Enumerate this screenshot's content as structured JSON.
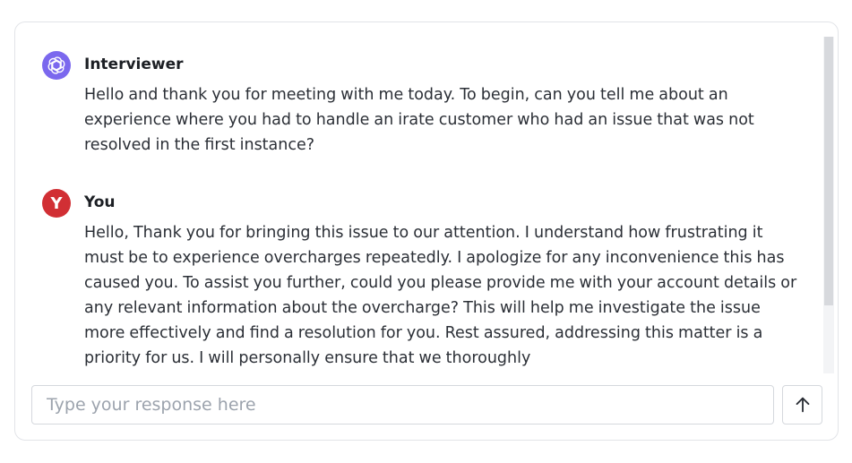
{
  "chat": {
    "messages": [
      {
        "sender": "Interviewer",
        "avatar_icon": "openai-logo-icon",
        "avatar_color": "#7b68ee",
        "text": "Hello and thank you for meeting with me today. To begin, can you tell me about an experience where you had to handle an irate customer who had an issue that was not resolved in the first instance?"
      },
      {
        "sender": "You",
        "avatar_letter": "Y",
        "avatar_color": "#d12f34",
        "text": "Hello, Thank you for bringing this issue to our attention. I understand how frustrating it must be to experience overcharges repeatedly. I apologize for any inconvenience this has caused you. To assist you further, could you please provide me with your account details or any relevant information about the overcharge? This will help me investigate the issue more effectively and find a resolution for you. Rest assured, addressing this matter is a priority for us. I will personally ensure that we thoroughly"
      }
    ]
  },
  "composer": {
    "placeholder": "Type your response here",
    "value": "",
    "send_icon": "arrow-up-icon"
  }
}
